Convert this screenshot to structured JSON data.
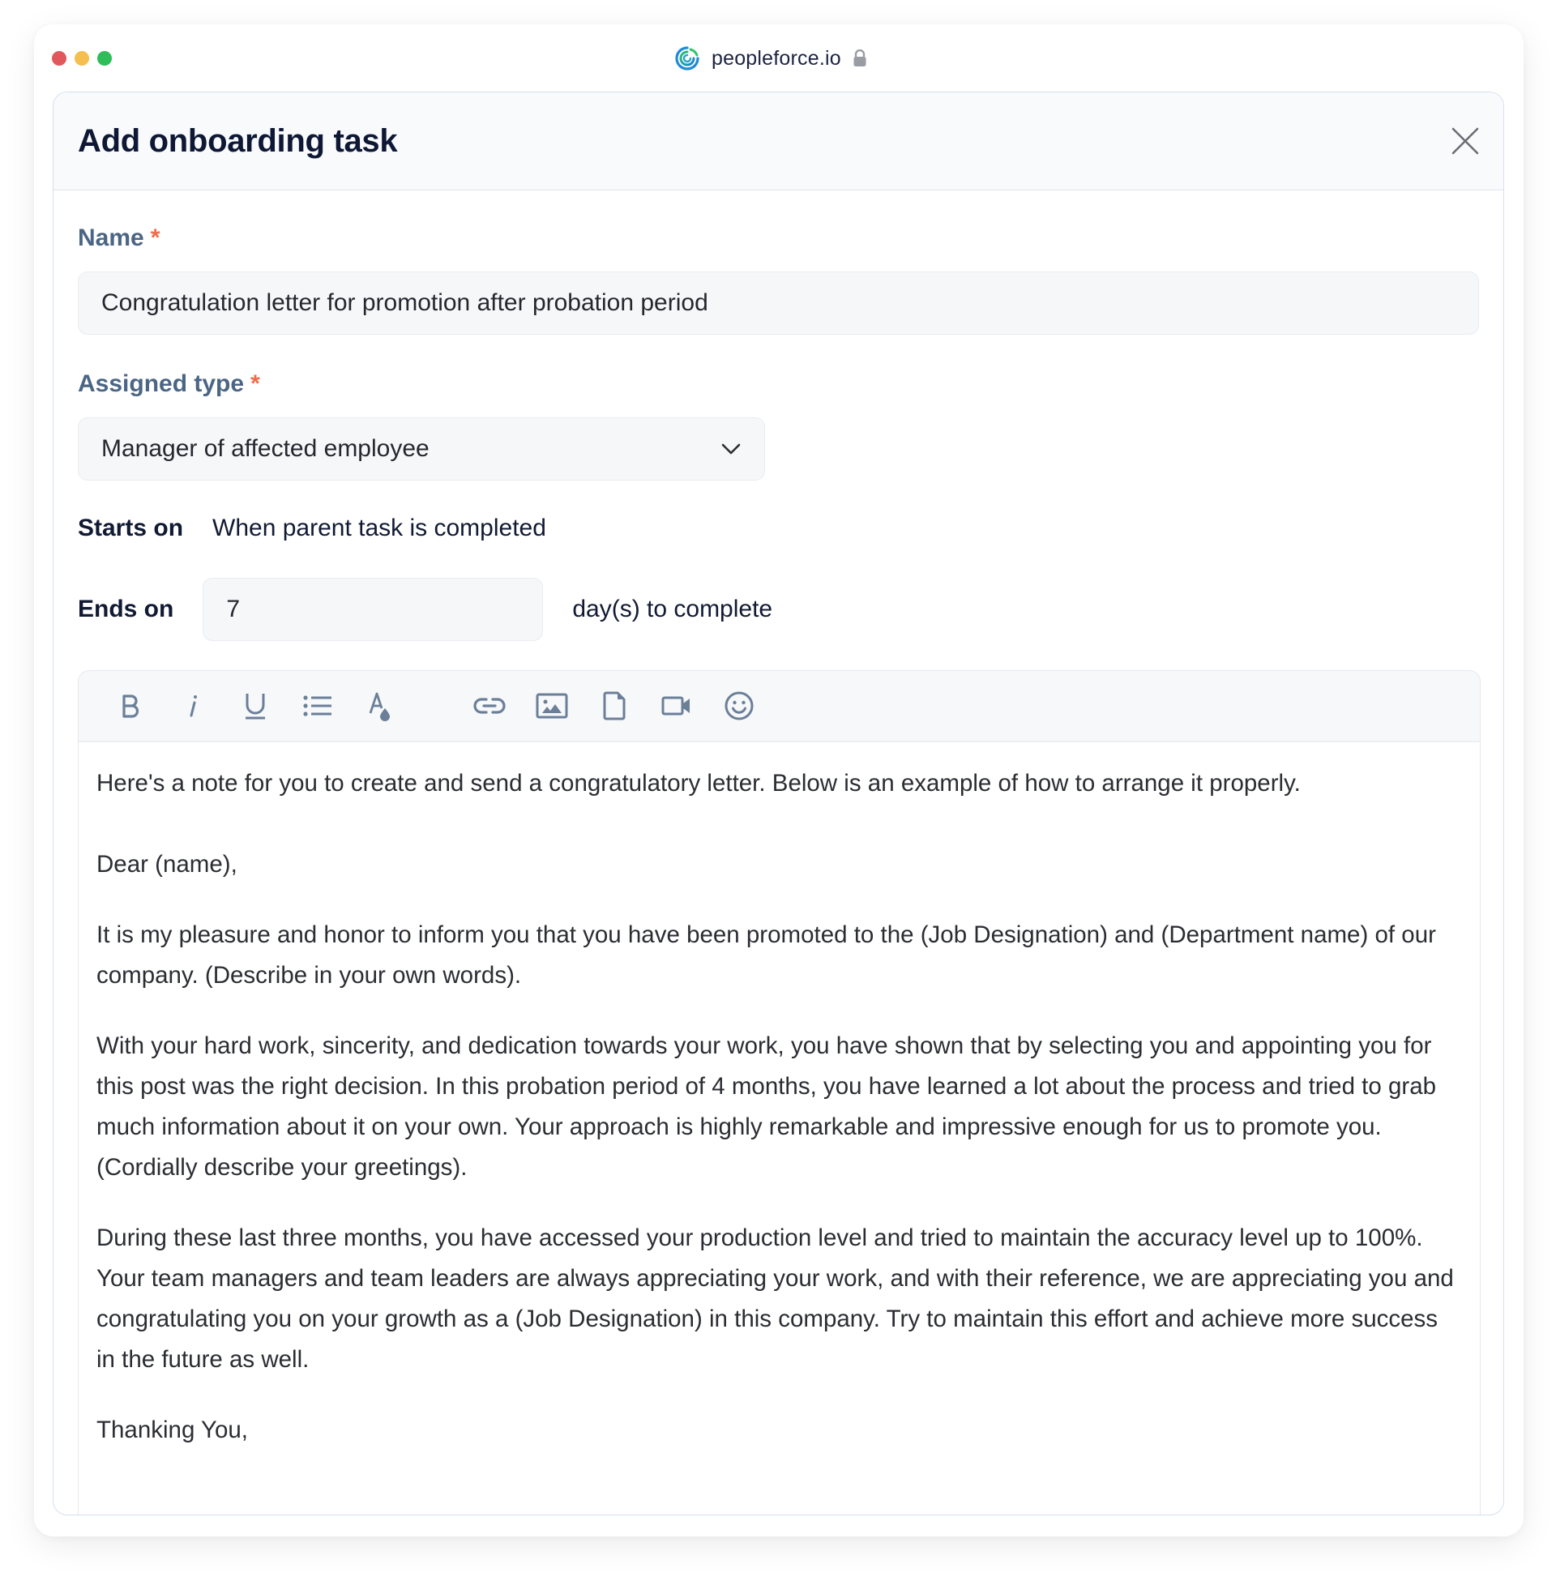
{
  "browser": {
    "url": "peopleforce.io",
    "logo_icon": "peopleforce-logo-icon",
    "lock_icon": "lock-icon",
    "traffic_colors": {
      "close": "#e0585b",
      "minimize": "#f5bf4f",
      "maximize": "#2ebd59"
    }
  },
  "dialog": {
    "title": "Add onboarding task",
    "close_icon": "close-icon"
  },
  "form": {
    "name": {
      "label": "Name",
      "required_mark": "*",
      "value": "Congratulation letter for promotion after probation period"
    },
    "assigned_type": {
      "label": "Assigned type",
      "required_mark": "*",
      "selected": "Manager of affected employee",
      "icon": "chevron-down-icon"
    },
    "starts_on": {
      "label": "Starts on",
      "value": "When parent task is completed"
    },
    "ends_on": {
      "label": "Ends on",
      "value": "7",
      "suffix": "day(s) to complete"
    }
  },
  "editor": {
    "toolbar": [
      {
        "name": "bold",
        "icon": "bold-icon"
      },
      {
        "name": "italic",
        "icon": "italic-icon"
      },
      {
        "name": "underline",
        "icon": "underline-icon"
      },
      {
        "name": "bullet-list",
        "icon": "list-icon"
      },
      {
        "name": "text-color",
        "icon": "text-color-icon"
      },
      {
        "name": "link",
        "icon": "link-icon"
      },
      {
        "name": "image",
        "icon": "image-icon"
      },
      {
        "name": "file",
        "icon": "file-icon"
      },
      {
        "name": "video",
        "icon": "video-icon"
      },
      {
        "name": "emoji",
        "icon": "emoji-icon"
      }
    ],
    "content": {
      "intro": "Here's a note for you to create and send a congratulatory letter. Below is an example of how to arrange it properly.",
      "greeting": "Dear (name),",
      "paragraphs": [
        "It is my pleasure and honor to inform you that you have been promoted to the (Job Designation) and (Department name) of our company. (Describe in your own words).",
        "With your hard work, sincerity, and dedication towards your work, you have shown that by selecting you and appointing you for this post was the right decision. In this probation period of 4 months, you have learned a lot about the process and tried to grab much information about it on your own. Your approach is highly remarkable and impressive enough for us to promote you. (Cordially describe your greetings).",
        "During these last three months, you have accessed your production level and tried to maintain the accuracy level up to 100%. Your team managers and team leaders are always appreciating your work, and with their reference, we are appreciating you and congratulating you on your growth as a (Job Designation) in this company. Try to maintain this effort and achieve more success in the future as well."
      ],
      "closing": "Thanking You,"
    }
  },
  "colors": {
    "label": "#4b6584",
    "required": "#ef6b48",
    "title": "#0e1834",
    "icon": "#6b7f99"
  }
}
